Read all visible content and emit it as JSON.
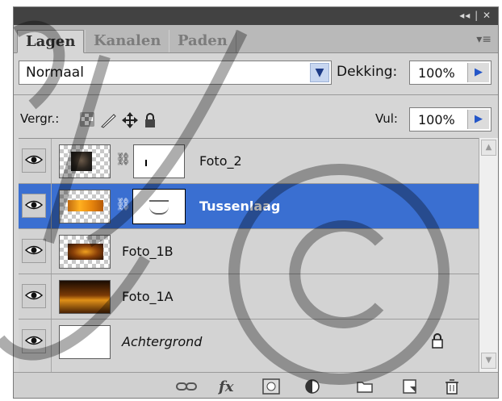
{
  "panel": {
    "title_controls": "◂◂ | ✕",
    "menu_glyph": "▾≡",
    "tabs": [
      {
        "label": "Lagen",
        "active": true
      },
      {
        "label": "Kanalen",
        "active": false
      },
      {
        "label": "Paden",
        "active": false
      }
    ]
  },
  "blend": {
    "mode": "Normaal",
    "opacity_label": "Dekking:",
    "opacity_value": "100%"
  },
  "lock": {
    "label": "Vergr.:",
    "fill_label": "Vul:",
    "fill_value": "100%"
  },
  "layers": [
    {
      "name": "Foto_2",
      "selected": false,
      "has_mask": true,
      "italic": false
    },
    {
      "name": "Tussenlaag",
      "selected": true,
      "has_mask": true,
      "italic": false
    },
    {
      "name": "Foto_1B",
      "selected": false,
      "has_mask": false,
      "italic": false
    },
    {
      "name": "Foto_1A",
      "selected": false,
      "has_mask": false,
      "italic": false
    },
    {
      "name": "Achtergrond",
      "selected": false,
      "has_mask": false,
      "italic": true,
      "locked": true
    }
  ],
  "bottom_icons": [
    "link-layers-icon",
    "fx-icon",
    "add-mask-icon",
    "adjustment-layer-icon",
    "new-group-icon",
    "new-layer-icon",
    "delete-layer-icon"
  ],
  "bottom_labels": {
    "fx": "fx"
  },
  "colors": {
    "selected": "#3a6fd1",
    "panel_bg": "#d6d6d6",
    "titlebar": "#424242"
  }
}
